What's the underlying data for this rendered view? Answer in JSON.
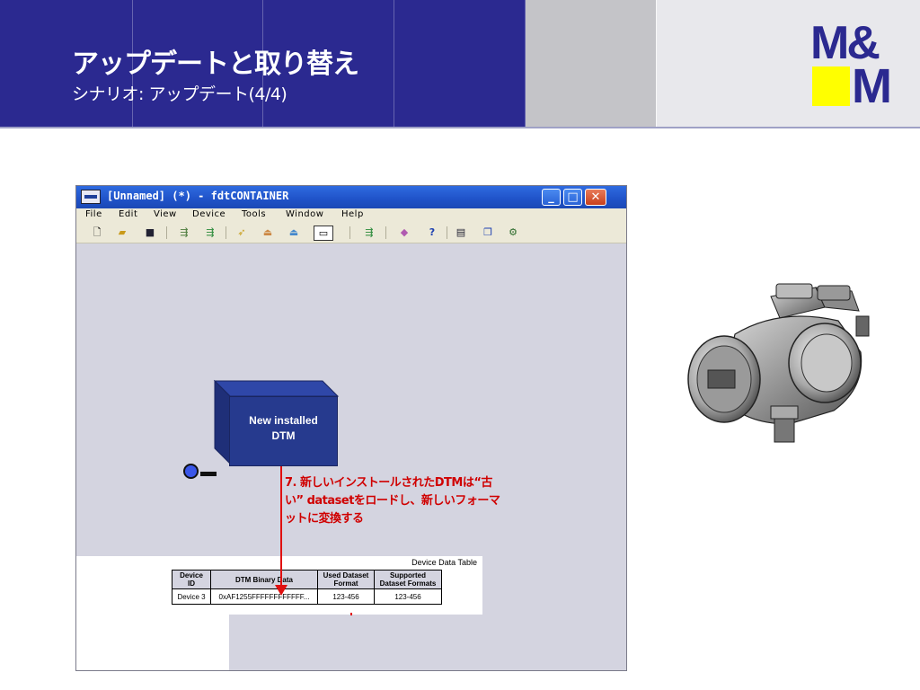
{
  "header": {
    "title": "アップデートと取り替え",
    "subtitle": "シナリオ: アップデート(4/4)",
    "logo_top": "M&",
    "logo_bottom": "M",
    "colors": {
      "banner": "#2b2990",
      "logo_yellow": "#ffff00"
    }
  },
  "window": {
    "title": "[Unnamed] (*) - fdtCONTAINER",
    "controls": {
      "minimize": "_",
      "maximize": "□",
      "close": "✕"
    },
    "menu": [
      "File",
      "Edit",
      "View",
      "Device",
      "Tools",
      "Window",
      "Help"
    ],
    "toolbar_icons": [
      "new-icon",
      "open-icon",
      "save-icon",
      "topology-icon",
      "topology-add-icon",
      "connect-icon",
      "upload-icon",
      "download-icon",
      "dtm-icon",
      "hart-icon",
      "eraser-icon",
      "help-icon",
      "window-icon",
      "properties-icon",
      "tool-icon"
    ]
  },
  "diagram": {
    "dtm_box": {
      "line1": "New installed",
      "line2": "DTM"
    },
    "note": "7. 新しいインストールされたDTMは“古い” datasetをロードし、新しいフォーマットに変換する"
  },
  "table": {
    "caption": "Device Data Table",
    "headers": [
      "Device ID",
      "DTM Binary Data",
      "Used Dataset Format",
      "Supported Dataset Formats"
    ],
    "rows": [
      [
        "Device 3",
        "0xAF1255FFFFFFFFFFFF...",
        "123-456",
        "123-456"
      ]
    ]
  }
}
